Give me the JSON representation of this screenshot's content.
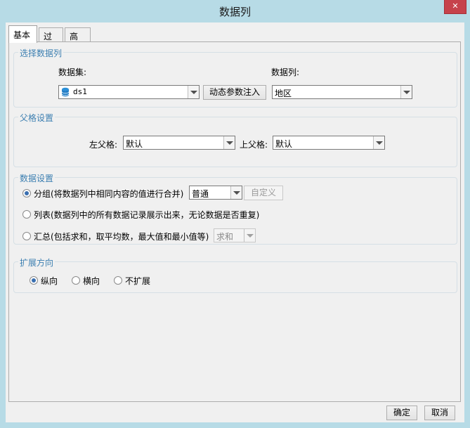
{
  "window": {
    "title": "数据列",
    "close_glyph": "✕"
  },
  "tabs": [
    {
      "label": "基本",
      "active": true
    },
    {
      "label": "过滤",
      "active": false
    },
    {
      "label": "高级",
      "active": false
    }
  ],
  "select_column": {
    "title": "选择数据列",
    "dataset_label": "数据集:",
    "dataset_value": "ds1",
    "dataset_icon": "database-icon",
    "dynamic_param_button": "动态参数注入",
    "column_label": "数据列:",
    "column_value": "地区"
  },
  "parent_settings": {
    "title": "父格设置",
    "left_parent_label": "左父格:",
    "left_parent_value": "默认",
    "up_parent_label": "上父格:",
    "up_parent_value": "默认"
  },
  "data_settings": {
    "title": "数据设置",
    "group_label": "分组(将数据列中相同内容的值进行合并)",
    "group_mode_value": "普通",
    "custom_button": "自定义",
    "list_label": "列表(数据列中的所有数据记录展示出来，无论数据是否重复)",
    "summary_label": "汇总(包括求和，取平均数，最大值和最小值等)",
    "summary_value": "求和",
    "selected": "group"
  },
  "expand_direction": {
    "title": "扩展方向",
    "options": [
      "纵向",
      "横向",
      "不扩展"
    ],
    "selected": "纵向"
  },
  "footer": {
    "ok_label": "确定",
    "cancel_label": "取消"
  },
  "colors": {
    "accent_title": "#3c7fb1",
    "frame": "#b7dbe6",
    "close": "#c6424b"
  }
}
